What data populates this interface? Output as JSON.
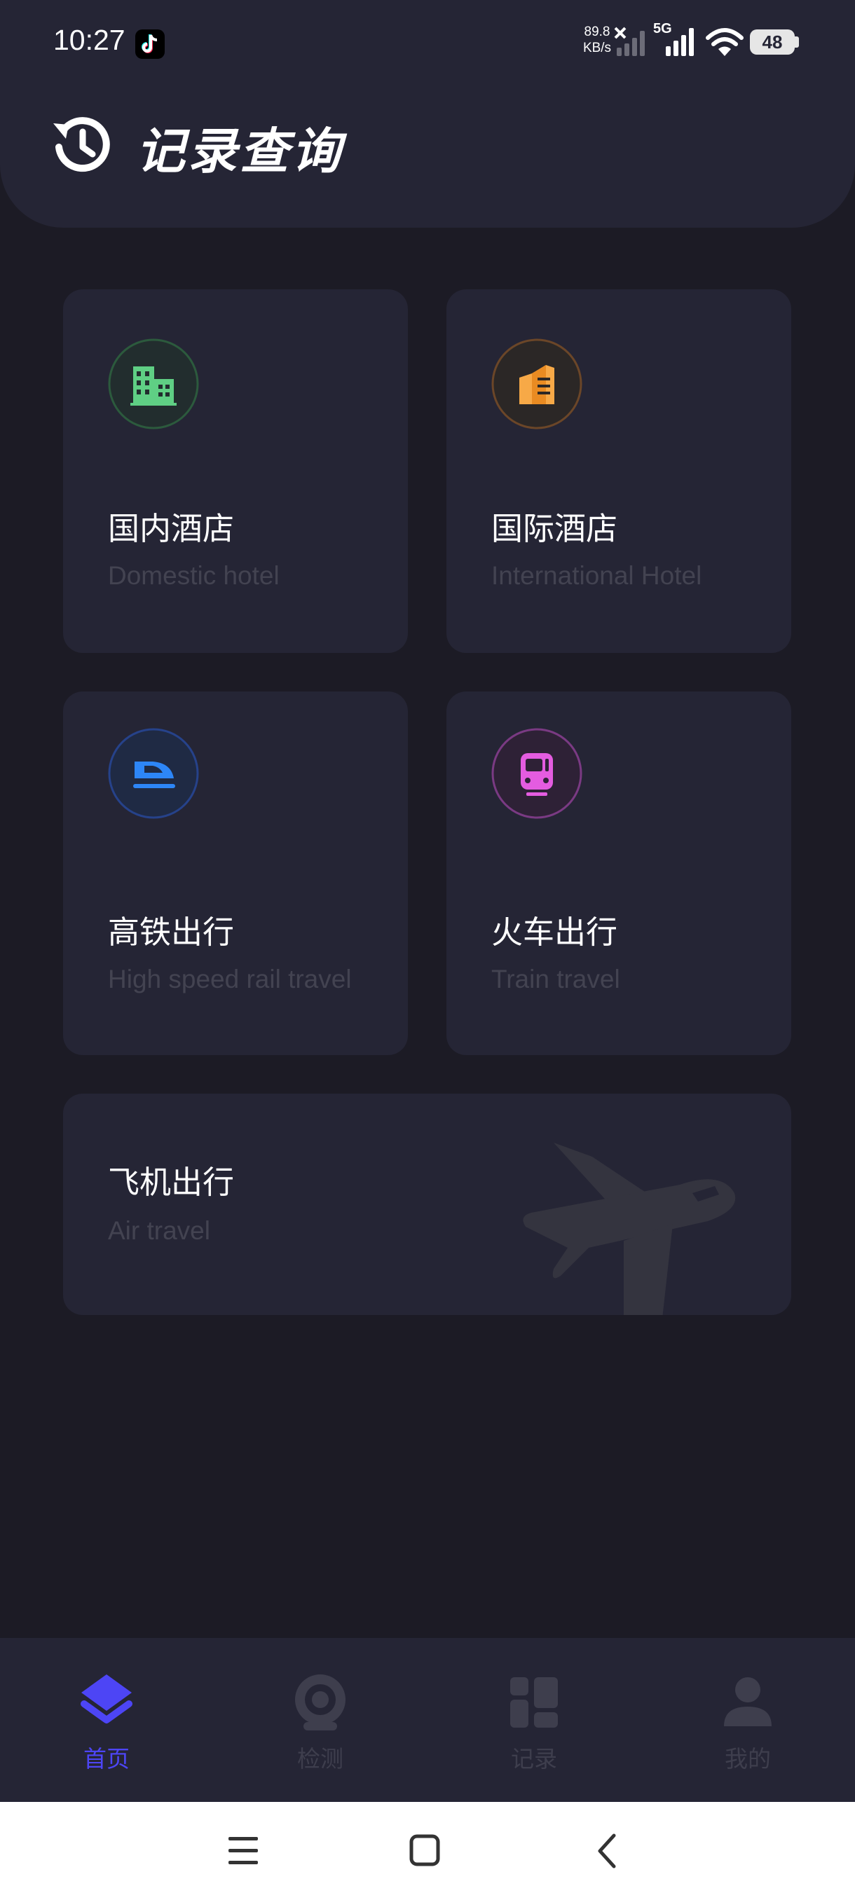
{
  "status_bar": {
    "time": "10:27",
    "net_speed_value": "89.8",
    "net_speed_unit": "KB/s",
    "network_type": "5G",
    "battery": "48"
  },
  "header": {
    "title": "记录查询",
    "icon": "history-icon"
  },
  "cards": [
    {
      "title": "国内酒店",
      "subtitle": "Domestic hotel",
      "icon": "hotel-building-icon",
      "accent": "#4caf6a"
    },
    {
      "title": "国际酒店",
      "subtitle": "International Hotel",
      "icon": "international-building-icon",
      "accent": "#f29a2e"
    },
    {
      "title": "高铁出行",
      "subtitle": "High speed rail travel",
      "icon": "high-speed-train-icon",
      "accent": "#2f7ef6"
    },
    {
      "title": "火车出行",
      "subtitle": "Train travel",
      "icon": "train-icon",
      "accent": "#d94fd6"
    },
    {
      "title": "飞机出行",
      "subtitle": "Air travel",
      "icon": "airplane-icon",
      "accent": "#3a3a48"
    }
  ],
  "bottom_nav": [
    {
      "label": "首页",
      "icon": "layers-icon",
      "active": true
    },
    {
      "label": "检测",
      "icon": "camera-icon",
      "active": false
    },
    {
      "label": "记录",
      "icon": "grid-icon",
      "active": false
    },
    {
      "label": "我的",
      "icon": "user-icon",
      "active": false
    }
  ],
  "colors": {
    "background": "#1c1b25",
    "card": "#252535",
    "active_tab": "#4d45f5",
    "inactive_tab": "#3e3e4d",
    "subtitle": "#434351"
  }
}
